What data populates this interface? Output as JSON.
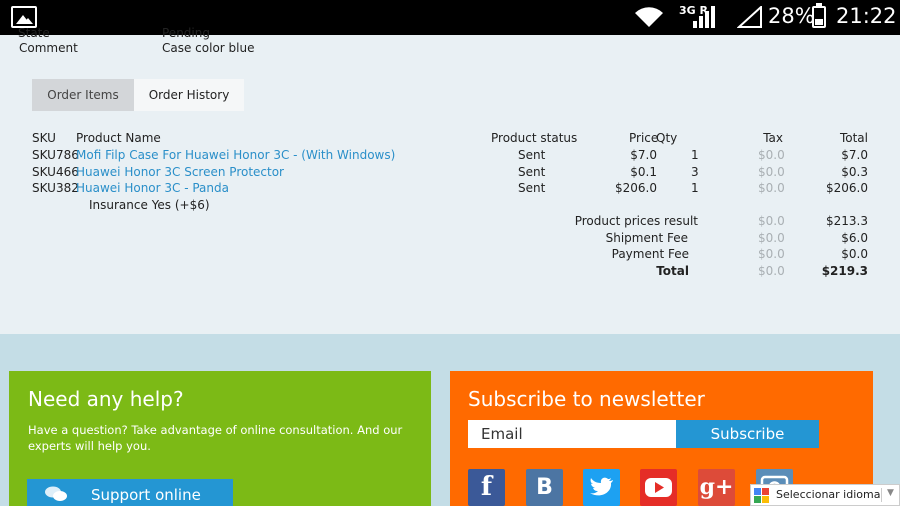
{
  "status_bar": {
    "network": "3G R",
    "battery_percent": "28%",
    "time": "21:22"
  },
  "order_info": {
    "cut_label": "State",
    "cut_value": "Pending",
    "comment_label": "Comment",
    "comment_value": "Case color blue"
  },
  "tabs": [
    {
      "label": "Order Items",
      "active": true
    },
    {
      "label": "Order History",
      "active": false
    }
  ],
  "table": {
    "headers": {
      "sku": "SKU",
      "name": "Product Name",
      "status": "Product status",
      "price": "Price",
      "qty": "Qty",
      "tax": "Tax",
      "total": "Total"
    },
    "rows": [
      {
        "sku": "SKU786",
        "name": "Mofi Filp Case For Huawei Honor 3C - (With Windows)",
        "status": "Sent",
        "price": "$7.0",
        "qty": "1",
        "tax": "$0.0",
        "total": "$7.0"
      },
      {
        "sku": "SKU466",
        "name": "Huawei Honor 3C Screen Protector",
        "status": "Sent",
        "price": "$0.1",
        "qty": "3",
        "tax": "$0.0",
        "total": "$0.3"
      },
      {
        "sku": "SKU382",
        "name": "Huawei Honor 3C - Panda",
        "status": "Sent",
        "price": "$206.0",
        "qty": "1",
        "tax": "$0.0",
        "total": "$206.0"
      }
    ],
    "option_note": "Insurance Yes (+$6)",
    "summary": [
      {
        "label": "Product prices result",
        "tax": "$0.0",
        "total": "$213.3",
        "bold": false
      },
      {
        "label": "Shipment Fee",
        "tax": "$0.0",
        "total": "$6.0",
        "bold": false
      },
      {
        "label": "Payment Fee",
        "tax": "$0.0",
        "total": "$0.0",
        "bold": false
      },
      {
        "label": "Total",
        "tax": "$0.0",
        "total": "$219.3",
        "bold": true
      }
    ]
  },
  "help": {
    "title": "Need any help?",
    "text": "Have a question? Take advantage of online consultation. And our experts will help you.",
    "button": "Support online"
  },
  "newsletter": {
    "title": "Subscribe to newsletter",
    "email_placeholder": "Email",
    "button": "Subscribe"
  },
  "social": [
    {
      "icon": "facebook-icon",
      "glyph": "f",
      "color": "#3b5998"
    },
    {
      "icon": "vk-icon",
      "glyph": "B",
      "color": "#4c75a3"
    },
    {
      "icon": "twitter-icon",
      "glyph": "t",
      "color": "#1da1f2"
    },
    {
      "icon": "youtube-icon",
      "glyph": "▶",
      "color": "#e52d27"
    },
    {
      "icon": "googleplus-icon",
      "glyph": "g+",
      "color": "#dd4b39"
    },
    {
      "icon": "camera-icon",
      "glyph": "◉",
      "color": "#5b8db8"
    }
  ],
  "language": {
    "label": "Seleccionar idioma"
  },
  "colors": {
    "accent_blue": "#2496d3",
    "help_green": "#7cba16",
    "news_orange": "#ff6a00",
    "link_blue": "#2a8fc9"
  }
}
